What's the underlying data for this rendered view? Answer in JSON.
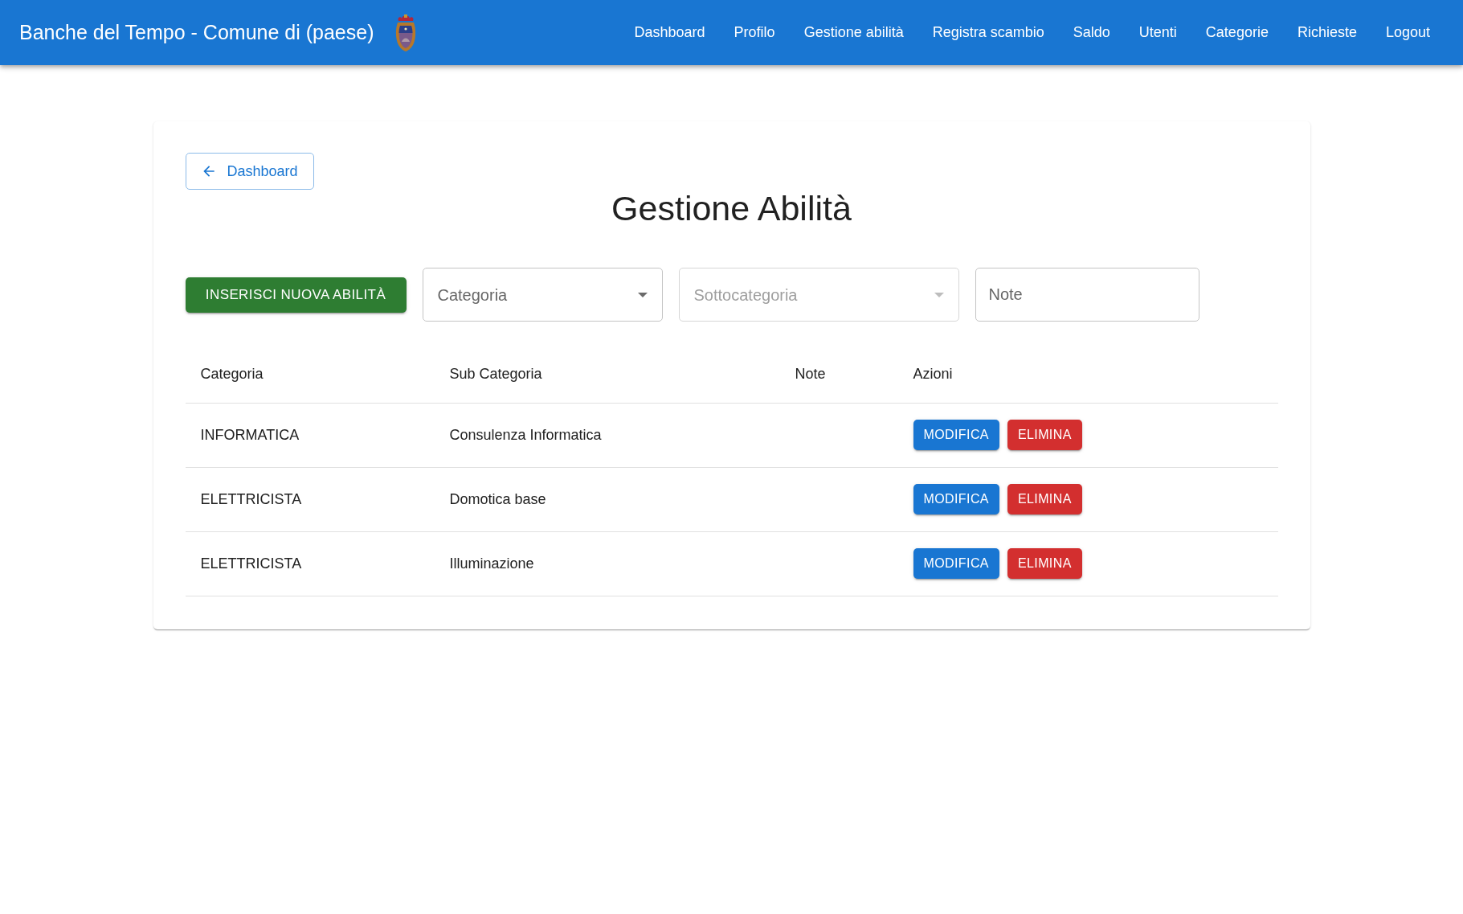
{
  "app_bar": {
    "title": "Banche del Tempo - Comune di (paese)",
    "nav": [
      {
        "label": "Dashboard"
      },
      {
        "label": "Profilo"
      },
      {
        "label": "Gestione abilità"
      },
      {
        "label": "Registra scambio"
      },
      {
        "label": "Saldo"
      },
      {
        "label": "Utenti"
      },
      {
        "label": "Categorie"
      },
      {
        "label": "Richieste"
      },
      {
        "label": "Logout"
      }
    ]
  },
  "page": {
    "back_button": "Dashboard",
    "title": "Gestione Abilità",
    "add_button": "INSERISCI NUOVA ABILITÀ",
    "filters": [
      {
        "kind": "select",
        "placeholder": "Categoria",
        "disabled": false
      },
      {
        "kind": "select",
        "placeholder": "Sottocategoria",
        "disabled": true
      },
      {
        "kind": "text",
        "placeholder": "Note",
        "disabled": false
      }
    ],
    "table": {
      "columns": [
        "Categoria",
        "Sub Categoria",
        "Note",
        "Azioni"
      ],
      "rows": [
        {
          "categoria": "INFORMATICA",
          "sub_categoria": "Consulenza Informatica",
          "actions": [
            {
              "label": "MODIFICA",
              "kind": "edit"
            },
            {
              "label": "ELIMINA",
              "kind": "delete"
            }
          ]
        },
        {
          "categoria": "ELETTRICISTA",
          "sub_categoria": "Domotica base",
          "actions": [
            {
              "label": "MODIFICA",
              "kind": "edit"
            },
            {
              "label": "ELIMINA",
              "kind": "delete"
            }
          ]
        },
        {
          "categoria": "ELETTRICISTA",
          "sub_categoria": "Illuminazione",
          "actions": [
            {
              "label": "MODIFICA",
              "kind": "edit"
            },
            {
              "label": "ELIMINA",
              "kind": "delete"
            }
          ]
        }
      ]
    }
  }
}
